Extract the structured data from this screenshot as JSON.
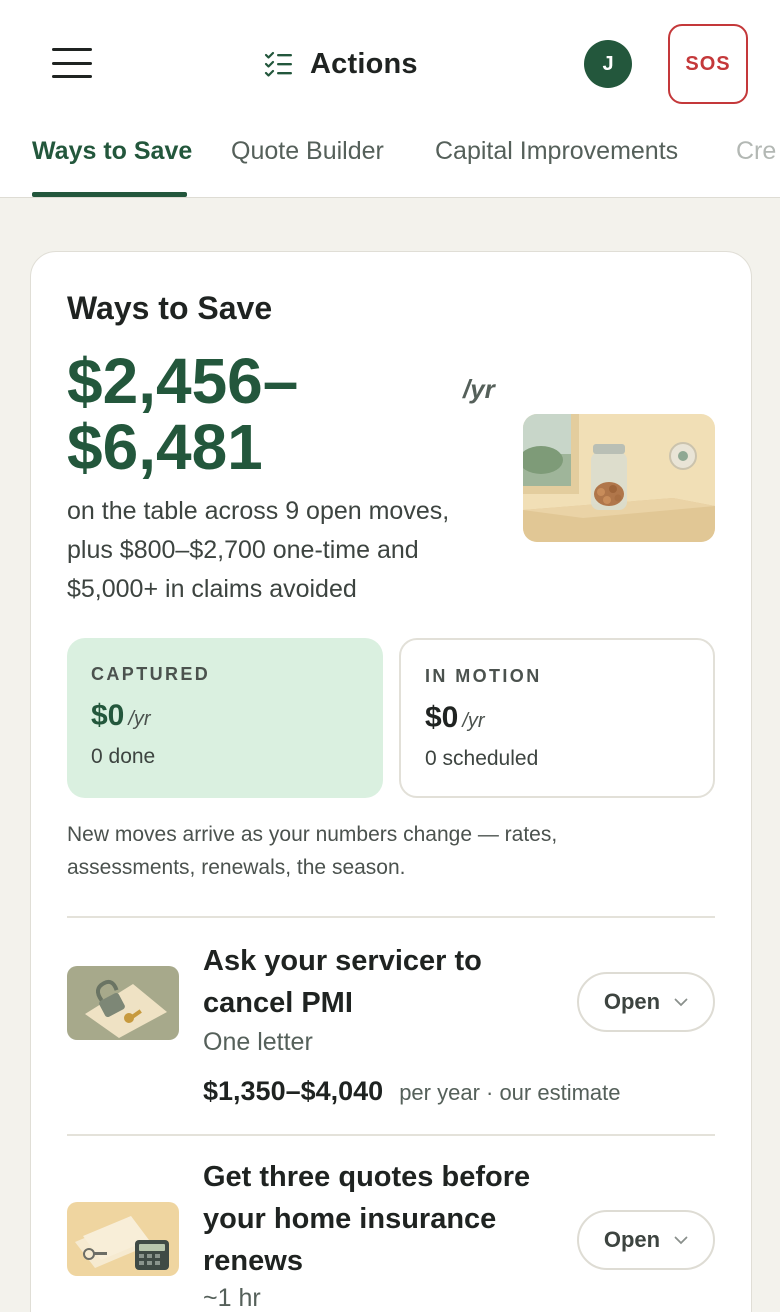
{
  "header": {
    "title": "Actions",
    "avatar_initial": "J",
    "sos_label": "SOS"
  },
  "tabs": [
    {
      "label": "Ways to Save",
      "active": true
    },
    {
      "label": "Quote Builder",
      "active": false
    },
    {
      "label": "Capital Improvements",
      "active": false
    },
    {
      "label": "Cre",
      "active": false
    }
  ],
  "card": {
    "title": "Ways to Save",
    "amount_line1": "$2,456–",
    "amount_line2": "$6,481",
    "per_year": "/yr",
    "summary_line1": "on the table across 9 open moves,",
    "summary_line2": "plus $800–$2,700 one-time and",
    "summary_line3": "$5,000+ in claims avoided",
    "captured": {
      "label": "CAPTURED",
      "value": "$0",
      "unit": "/yr",
      "sub": "0 done"
    },
    "in_motion": {
      "label": "IN MOTION",
      "value": "$0",
      "unit": "/yr",
      "sub": "0 scheduled"
    },
    "note_line1": "New moves arrive as your numbers change — rates,",
    "note_line2": "assessments, renewals, the season."
  },
  "moves": [
    {
      "title_line1": "Ask your servicer to",
      "title_line2": "cancel PMI",
      "effort": "One letter",
      "amount": "$1,350–$4,040",
      "per": "per year · our estimate",
      "button": "Open",
      "thumb_icon": "padlock-key-icon"
    },
    {
      "title_line1": "Get three quotes before",
      "title_line2": "your home insurance",
      "title_line3": "renews",
      "effort": "~1 hr",
      "button": "Open",
      "thumb_icon": "calculator-papers-icon"
    }
  ],
  "colors": {
    "brand_green": "#23573c",
    "captured_bg": "#daf0e0",
    "sos_red": "#c4383a",
    "page_bg": "#f3f2ec"
  }
}
